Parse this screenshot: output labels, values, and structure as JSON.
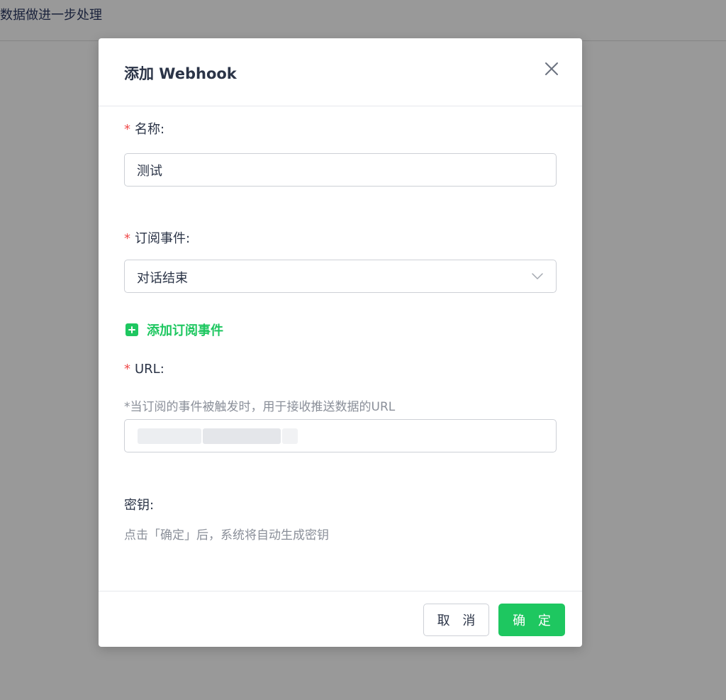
{
  "background": {
    "text": "数据做进一步处理"
  },
  "dialog": {
    "title": "添加 Webhook",
    "fields": {
      "name": {
        "required_mark": "*",
        "label": "名称:",
        "value": "测试"
      },
      "event": {
        "required_mark": "*",
        "label": "订阅事件:",
        "value": "对话结束"
      },
      "add_event_label": "添加订阅事件",
      "url": {
        "required_mark": "*",
        "label": "URL:",
        "hint": "*当订阅的事件被触发时，用于接收推送数据的URL"
      },
      "secret": {
        "label": "密钥:",
        "hint": "点击「确定」后，系统将自动生成密钥"
      }
    },
    "footer": {
      "cancel_label": "取 消",
      "ok_label": "确 定"
    }
  },
  "colors": {
    "accent": "#1ec760",
    "required": "#f04b4b",
    "text": "#2b3447",
    "muted": "#8a8f99"
  },
  "icons": {
    "close": "close-icon",
    "chevron": "chevron-down-icon",
    "add": "plus-square-icon"
  }
}
